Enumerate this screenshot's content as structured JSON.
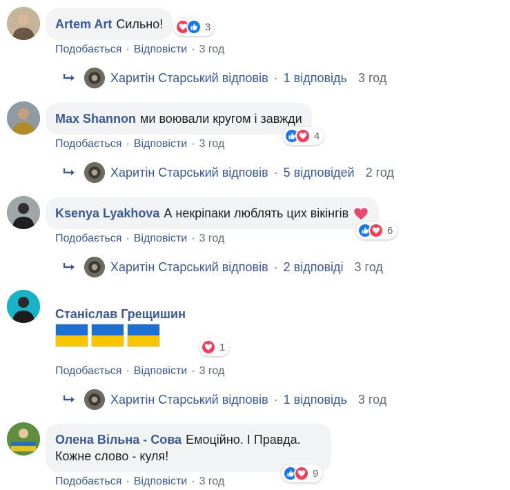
{
  "comments": [
    {
      "author": "Artem Art",
      "text": "Сильно!",
      "reaction_count": "3",
      "reactions": [
        "love-icon",
        "like-icon"
      ],
      "like_label": "Подобається",
      "reply_label": "Відповісти",
      "time": "3 год",
      "reply_summary": {
        "name": "Харитін Старський відповів",
        "count": "1 відповідь",
        "time": "3 год"
      }
    },
    {
      "author": "Max Shannon",
      "text": "ми воювали кругом і завжди",
      "reaction_count": "4",
      "reactions": [
        "like-icon",
        "love-icon"
      ],
      "like_label": "Подобається",
      "reply_label": "Відповісти",
      "time": "3 год",
      "reply_summary": {
        "name": "Харитін Старський відповів",
        "count": "5 відповідей",
        "time": "2 год"
      }
    },
    {
      "author": "Ksenya Lyakhova",
      "text": "А некріпаки люблять цих вікінгів",
      "reaction_count": "6",
      "reactions": [
        "like-icon",
        "love-icon"
      ],
      "like_label": "Подобається",
      "reply_label": "Відповісти",
      "time": "3 год",
      "reply_summary": {
        "name": "Харитін Старський відповів",
        "count": "2 відповіді",
        "time": "3 год"
      }
    },
    {
      "author": "Станіслав Грещишин",
      "text": "",
      "reaction_count": "1",
      "reactions": [
        "love-icon"
      ],
      "like_label": "Подобається",
      "reply_label": "Відповісти",
      "time": "3 год",
      "reply_summary": {
        "name": "Харитін Старський відповів",
        "count": "1 відповідь",
        "time": "3 год"
      }
    },
    {
      "author": "Олена Вільна - Сова",
      "text_line1": "Емоційно. І Правда.",
      "text_line2": "Кожне слово - куля!",
      "reaction_count": "9",
      "reactions": [
        "like-icon",
        "love-icon"
      ],
      "like_label": "Подобається",
      "reply_label": "Відповісти",
      "time": "3 год"
    }
  ],
  "colors": {
    "link": "#385898",
    "bubble": "#f2f3f5",
    "meta": "#606770",
    "love": "#f33e58",
    "like": "#1877f2",
    "flag_blue": "#1d6fd1",
    "flag_yellow": "#f7c600"
  }
}
